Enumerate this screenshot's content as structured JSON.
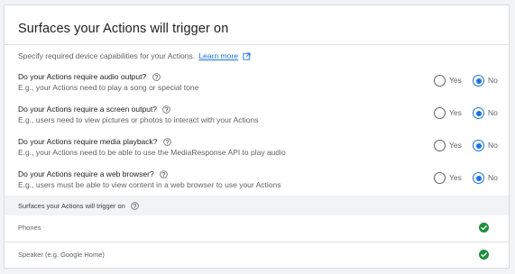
{
  "section": {
    "title": "Surfaces your Actions will trigger on",
    "description": "Specify required device capabilities for your Actions.",
    "learn_more": "Learn more"
  },
  "questions": [
    {
      "label": "Do your Actions require audio output?",
      "hint": "E.g., your Actions need to play a song or special tone",
      "yes": "Yes",
      "no": "No",
      "selected": "No"
    },
    {
      "label": "Do your Actions require a screen output?",
      "hint": "E.g., users need to view pictures or photos to interact with your Actions",
      "yes": "Yes",
      "no": "No",
      "selected": "No"
    },
    {
      "label": "Do your Actions require media playback?",
      "hint": "E.g., your Actions need to be able to use the MediaResponse API to play audio",
      "yes": "Yes",
      "no": "No",
      "selected": "No"
    },
    {
      "label": "Do your Actions require a web browser?",
      "hint": "E.g., users must be able to view content in a web browser to use your Actions",
      "yes": "Yes",
      "no": "No",
      "selected": "No"
    }
  ],
  "surfaces": {
    "header": "Surfaces your Actions will trigger on",
    "items": [
      {
        "name": "Phones",
        "enabled": true
      },
      {
        "name": "Speaker (e.g. Google Home)",
        "enabled": true
      }
    ]
  },
  "colors": {
    "accent": "#1a73e8",
    "success": "#1e8e3e",
    "muted_text": "#5f6368",
    "header_bg": "#f1f3f4"
  },
  "icons": {
    "help": "help-circle-icon",
    "external": "open-in-new-icon",
    "check": "check-circle-icon"
  }
}
